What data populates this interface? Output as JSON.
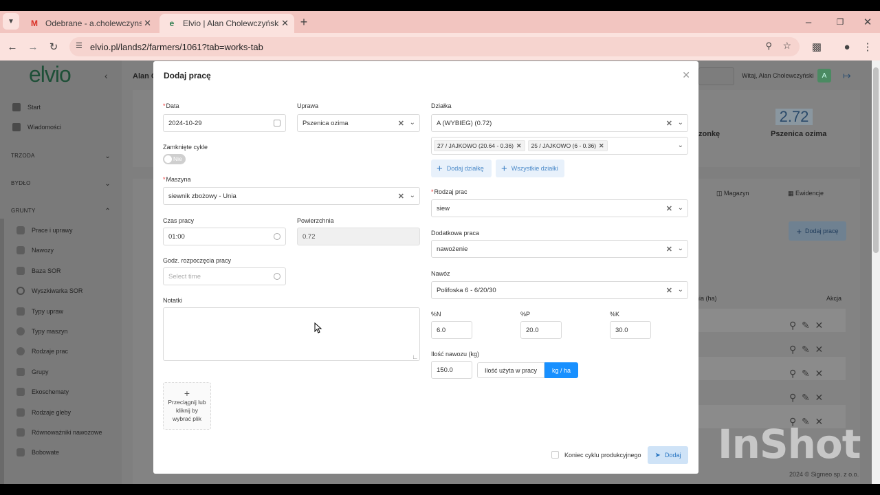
{
  "browser": {
    "tabs": [
      {
        "title": "Odebrane - a.cholewczynski@e",
        "icon": "gmail-icon"
      },
      {
        "title": "Elvio | Alan Cholewczyński - Gr",
        "icon": "elvio-icon"
      }
    ],
    "url": "elvio.pl/lands2/farmers/1061?tab=works-tab"
  },
  "app": {
    "logo": "elvio",
    "header_name": "Alan C",
    "welcome": "Witaj, Alan Cholewczyński",
    "avatar_letter": "A",
    "stat_value": "2.72",
    "stat_label": "Pszenica ozima",
    "stat_label2": "zonkę",
    "bg_tabs": [
      "Magazyn",
      "Ewidencje"
    ],
    "bg_add_label": "Dodaj pracę",
    "col_area": "nia (ha)",
    "col_action": "Akcja",
    "footer": "2024 © Sigmeo sp. z o.o.",
    "sidebar": {
      "top_items": [
        "Start",
        "Wiadomości"
      ],
      "sections": [
        "TRZODA",
        "BYDŁO",
        "GRUNTY"
      ],
      "grunty_items": [
        "Prace i uprawy",
        "Nawozy",
        "Baza SOR",
        "Wyszkiwarka SOR",
        "Typy upraw",
        "Typy maszyn",
        "Rodzaje prac",
        "Grupy",
        "Ekoschematy",
        "Rodzaje gleby",
        "Równoważniki nawozowe",
        "Bobowate"
      ]
    }
  },
  "modal": {
    "title": "Dodaj pracę",
    "data_label": "Data",
    "data_value": "2024-10-29",
    "uprawa_label": "Uprawa",
    "uprawa_value": "Pszenica ozima",
    "zamkniete_label": "Zamknięte cykle",
    "zamkniete_value": "Nie",
    "maszyna_label": "Maszyna",
    "maszyna_value": "siewnik zbożowy - Unia",
    "czas_label": "Czas pracy",
    "czas_value": "01:00",
    "powierzchnia_label": "Powierzchnia",
    "powierzchnia_value": "0.72",
    "godz_label": "Godz. rozpoczęcia pracy",
    "godz_placeholder": "Select time",
    "notatki_label": "Notatki",
    "upload_label_1": "Przeciągnij lub",
    "upload_label_2": "kliknij by",
    "upload_label_3": "wybrać plik",
    "dzialka_label": "Działka",
    "dzialka_value": "A (WYBIEG) (0.72)",
    "dzialka_tags": [
      "27 / JAJKOWO (20.64 - 0.36)",
      "25 / JAJKOWO (6 - 0.36)"
    ],
    "dodaj_dzialke": "Dodaj działkę",
    "wszystkie_dzialki": "Wszystkie działki",
    "rodzaj_label": "Rodzaj prac",
    "rodzaj_value": "siew",
    "dodatkowa_label": "Dodatkowa praca",
    "dodatkowa_value": "nawożenie",
    "nawoz_label": "Nawóz",
    "nawoz_value": "Polifoska 6 - 6/20/30",
    "n_label": "%N",
    "n_value": "6.0",
    "p_label": "%P",
    "p_value": "20.0",
    "k_label": "%K",
    "k_value": "30.0",
    "ilosc_label": "Ilość nawozu (kg)",
    "ilosc_value": "150.0",
    "seg_option_1": "Ilość użyta w pracy",
    "seg_option_2": "kg / ha",
    "koniec_label": "Koniec cyklu produkcyjnego",
    "submit_label": "Dodaj"
  },
  "watermark": "InShot",
  "colors": {
    "primary": "#1890ff",
    "tab_bar": "#f2c5c0",
    "required": "#e33"
  }
}
